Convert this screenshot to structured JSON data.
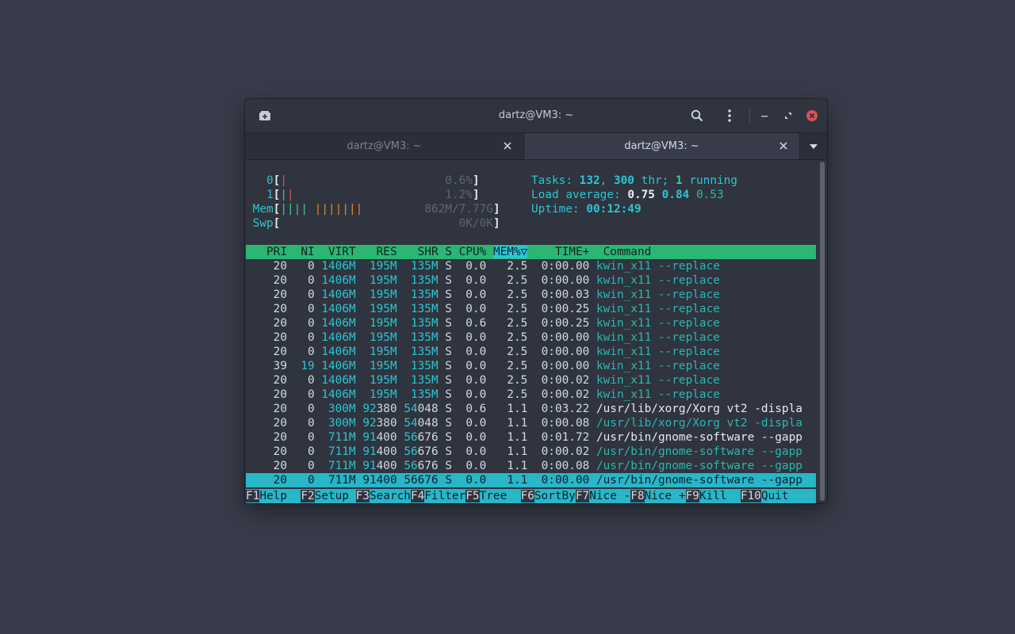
{
  "window": {
    "title": "dartz@VM3: ~",
    "tabs": [
      {
        "label": "dartz@VM3: ~",
        "active": false
      },
      {
        "label": "dartz@VM3: ~",
        "active": true
      }
    ]
  },
  "icons": [
    "new-tab-icon",
    "search-icon",
    "kebab-menu-icon",
    "minimize-icon",
    "restore-icon",
    "close-icon",
    "tab-close-icon",
    "tab-list-chevron-icon"
  ],
  "colors": {
    "accent_green": "#2bb673",
    "accent_cyan": "#29c7d2",
    "close_red": "#e04f54",
    "background": "#383c4a"
  },
  "meters": {
    "cpu0": {
      "label": "0",
      "value": "0.6%",
      "fraction": 0.006
    },
    "cpu1": {
      "label": "1",
      "value": "1.2%",
      "fraction": 0.012
    },
    "mem": {
      "label": "Mem",
      "value": "862M/7.77G"
    },
    "swp": {
      "label": "Swp",
      "value": "0K/0K"
    }
  },
  "info": {
    "tasks_label": "Tasks:",
    "tasks_count": "132",
    "threads": "300",
    "threads_suffix": "thr;",
    "running": "1",
    "running_label": "running",
    "load_label": "Load average:",
    "load1": "0.75",
    "load5": "0.84",
    "load15": "0.53",
    "uptime_label": "Uptime:",
    "uptime": "00:12:49"
  },
  "table": {
    "headers": [
      "PRI",
      "NI",
      "VIRT",
      "RES",
      "SHR",
      "S",
      "CPU%",
      "MEM%",
      "TIME+",
      "Command"
    ],
    "sort_column": "MEM%",
    "sort_indicator": "▽",
    "rows": [
      {
        "pri": "20",
        "ni": "0",
        "virt": "1406M",
        "res": "195M",
        "shr": "135M",
        "s": "S",
        "cpu": "0.0",
        "mem": "2.5",
        "time": "0:00.00",
        "cmd": "kwin_x11",
        "args": "--replace"
      },
      {
        "pri": "20",
        "ni": "0",
        "virt": "1406M",
        "res": "195M",
        "shr": "135M",
        "s": "S",
        "cpu": "0.0",
        "mem": "2.5",
        "time": "0:00.00",
        "cmd": "kwin_x11",
        "args": "--replace"
      },
      {
        "pri": "20",
        "ni": "0",
        "virt": "1406M",
        "res": "195M",
        "shr": "135M",
        "s": "S",
        "cpu": "0.0",
        "mem": "2.5",
        "time": "0:00.03",
        "cmd": "kwin_x11",
        "args": "--replace"
      },
      {
        "pri": "20",
        "ni": "0",
        "virt": "1406M",
        "res": "195M",
        "shr": "135M",
        "s": "S",
        "cpu": "0.0",
        "mem": "2.5",
        "time": "0:00.25",
        "cmd": "kwin_x11",
        "args": "--replace"
      },
      {
        "pri": "20",
        "ni": "0",
        "virt": "1406M",
        "res": "195M",
        "shr": "135M",
        "s": "S",
        "cpu": "0.6",
        "mem": "2.5",
        "time": "0:00.25",
        "cmd": "kwin_x11",
        "args": "--replace"
      },
      {
        "pri": "20",
        "ni": "0",
        "virt": "1406M",
        "res": "195M",
        "shr": "135M",
        "s": "S",
        "cpu": "0.0",
        "mem": "2.5",
        "time": "0:00.00",
        "cmd": "kwin_x11",
        "args": "--replace"
      },
      {
        "pri": "20",
        "ni": "0",
        "virt": "1406M",
        "res": "195M",
        "shr": "135M",
        "s": "S",
        "cpu": "0.0",
        "mem": "2.5",
        "time": "0:00.00",
        "cmd": "kwin_x11",
        "args": "--replace"
      },
      {
        "pri": "39",
        "ni": "19",
        "virt": "1406M",
        "res": "195M",
        "shr": "135M",
        "s": "S",
        "cpu": "0.0",
        "mem": "2.5",
        "time": "0:00.00",
        "cmd": "kwin_x11",
        "args": "--replace"
      },
      {
        "pri": "20",
        "ni": "0",
        "virt": "1406M",
        "res": "195M",
        "shr": "135M",
        "s": "S",
        "cpu": "0.0",
        "mem": "2.5",
        "time": "0:00.02",
        "cmd": "kwin_x11",
        "args": "--replace"
      },
      {
        "pri": "20",
        "ni": "0",
        "virt": "1406M",
        "res": "195M",
        "shr": "135M",
        "s": "S",
        "cpu": "0.0",
        "mem": "2.5",
        "time": "0:00.02",
        "cmd": "kwin_x11",
        "args": "--replace"
      },
      {
        "pri": "20",
        "ni": "0",
        "virt": "300M",
        "res": "92380",
        "shr": "54048",
        "s": "S",
        "cpu": "0.6",
        "mem": "1.1",
        "time": "0:03.22",
        "cmd": "/usr/lib/xorg/Xorg",
        "args": "vt2 -displa"
      },
      {
        "pri": "20",
        "ni": "0",
        "virt": "300M",
        "res": "92380",
        "shr": "54048",
        "s": "S",
        "cpu": "0.0",
        "mem": "1.1",
        "time": "0:00.08",
        "cmd": "/usr/lib/xorg/Xorg",
        "args": "vt2 -displa"
      },
      {
        "pri": "20",
        "ni": "0",
        "virt": "711M",
        "res": "91400",
        "shr": "56676",
        "s": "S",
        "cpu": "0.0",
        "mem": "1.1",
        "time": "0:01.72",
        "cmd": "/usr/bin/gnome-software",
        "args": "--gapp"
      },
      {
        "pri": "20",
        "ni": "0",
        "virt": "711M",
        "res": "91400",
        "shr": "56676",
        "s": "S",
        "cpu": "0.0",
        "mem": "1.1",
        "time": "0:00.02",
        "cmd": "/usr/bin/gnome-software",
        "args": "--gapp"
      },
      {
        "pri": "20",
        "ni": "0",
        "virt": "711M",
        "res": "91400",
        "shr": "56676",
        "s": "S",
        "cpu": "0.0",
        "mem": "1.1",
        "time": "0:00.08",
        "cmd": "/usr/bin/gnome-software",
        "args": "--gapp"
      },
      {
        "pri": "20",
        "ni": "0",
        "virt": "711M",
        "res": "91400",
        "shr": "56676",
        "s": "S",
        "cpu": "0.0",
        "mem": "1.1",
        "time": "0:00.00",
        "cmd": "/usr/bin/gnome-software",
        "args": "--gapp"
      }
    ],
    "selected_row": 15
  },
  "function_keys": [
    {
      "key": "F1",
      "label": "Help  "
    },
    {
      "key": "F2",
      "label": "Setup "
    },
    {
      "key": "F3",
      "label": "Search"
    },
    {
      "key": "F4",
      "label": "Filter"
    },
    {
      "key": "F5",
      "label": "Tree  "
    },
    {
      "key": "F6",
      "label": "SortBy"
    },
    {
      "key": "F7",
      "label": "Nice -"
    },
    {
      "key": "F8",
      "label": "Nice +"
    },
    {
      "key": "F9",
      "label": "Kill  "
    },
    {
      "key": "F10",
      "label": "Quit"
    }
  ]
}
